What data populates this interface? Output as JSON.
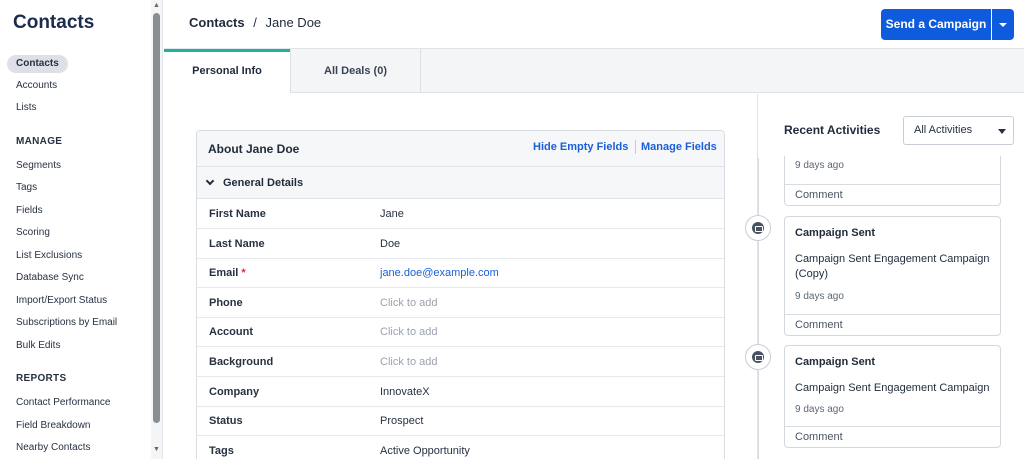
{
  "sidebar": {
    "title": "Contacts",
    "items": [
      {
        "label": "Contacts"
      },
      {
        "label": "Accounts"
      },
      {
        "label": "Lists"
      }
    ],
    "manage": {
      "heading": "MANAGE",
      "items": [
        "Segments",
        "Tags",
        "Fields",
        "Scoring",
        "List Exclusions",
        "Database Sync",
        "Import/Export Status",
        "Subscriptions by Email",
        "Bulk Edits"
      ]
    },
    "reports": {
      "heading": "REPORTS",
      "items": [
        "Contact Performance",
        "Field Breakdown",
        "Nearby Contacts"
      ]
    }
  },
  "header": {
    "breadcrumb_root": "Contacts",
    "breadcrumb_sep": "/",
    "breadcrumb_current": "Jane Doe",
    "primary_button": "Send a Campaign"
  },
  "tabs": [
    "Personal Info",
    "All Deals (0)"
  ],
  "about": {
    "title": "About Jane Doe",
    "hide_empty": "Hide Empty Fields",
    "manage_fields": "Manage Fields",
    "section": "General Details",
    "fields": [
      {
        "label": "First Name",
        "value": "Jane"
      },
      {
        "label": "Last Name",
        "value": "Doe"
      },
      {
        "label": "Email",
        "required": "*",
        "value": "jane.doe@example.com"
      },
      {
        "label": "Phone",
        "value": "Click to add"
      },
      {
        "label": "Account",
        "value": "Click to add"
      },
      {
        "label": "Background",
        "value": "Click to add"
      },
      {
        "label": "Company",
        "value": "InnovateX"
      },
      {
        "label": "Status",
        "value": "Prospect"
      },
      {
        "label": "Tags",
        "value": "Active Opportunity"
      }
    ]
  },
  "activities": {
    "title": "Recent Activities",
    "filter": "All Activities",
    "items": [
      {
        "time": "9 days ago",
        "comment": "Comment"
      },
      {
        "title": "Campaign Sent",
        "body": "Campaign Sent Engagement Campaign (Copy)",
        "time": "9 days ago",
        "comment": "Comment"
      },
      {
        "title": "Campaign Sent",
        "body": "Campaign Sent Engagement Campaign",
        "time": "9 days ago",
        "comment": "Comment"
      }
    ]
  },
  "colors": {
    "primary": "#0e5bdd",
    "tab_accent": "#1fb398",
    "link": "#1b5fd6",
    "required": "#d3303f"
  }
}
